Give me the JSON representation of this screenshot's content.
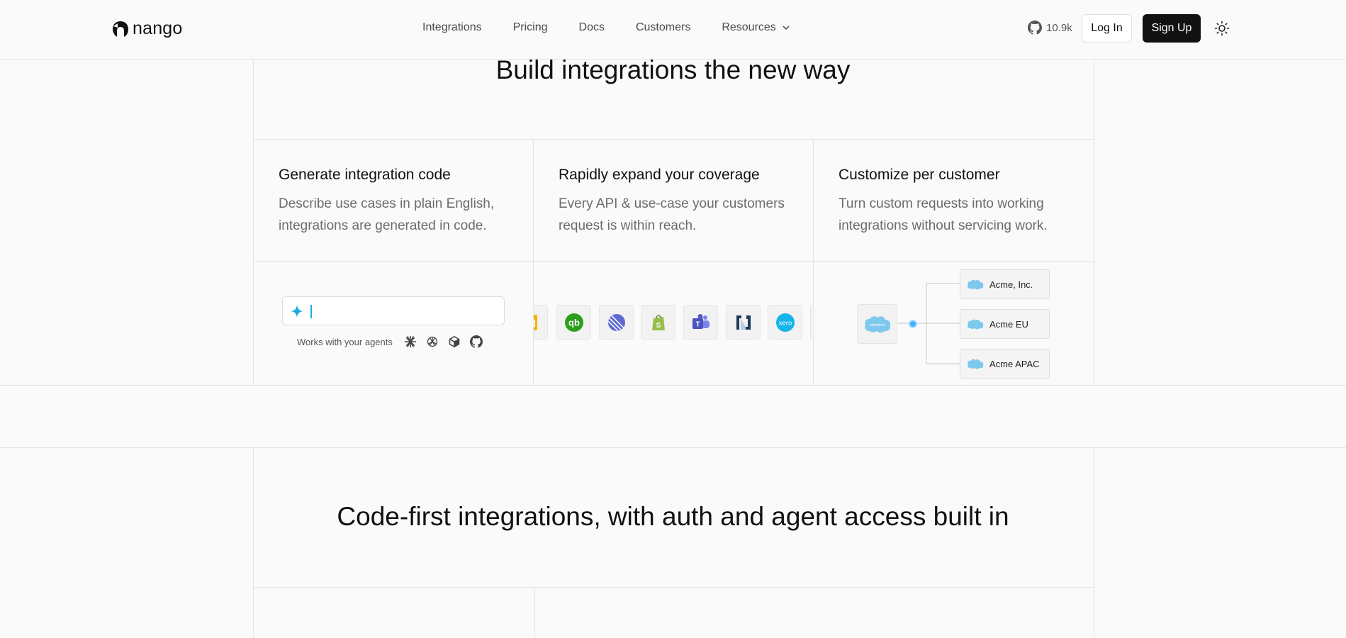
{
  "header": {
    "logo_text": "nango",
    "nav": [
      "Integrations",
      "Pricing",
      "Docs",
      "Customers",
      "Resources"
    ],
    "github_stars": "10.9k",
    "login_label": "Log In",
    "signup_label": "Sign Up"
  },
  "section1": {
    "title": "Build integrations the new way",
    "columns": [
      {
        "title": "Generate integration code",
        "desc": "Describe use cases in plain English, integrations are generated in code."
      },
      {
        "title": "Rapidly expand your coverage",
        "desc": "Every API & use-case your customers request is within reach."
      },
      {
        "title": "Customize per customer",
        "desc": "Turn custom requests into working integrations without servicing work."
      }
    ],
    "agents_label": "Works with your agents",
    "logo_icons": [
      "google-sheets-icon",
      "quickbooks-icon",
      "linear-icon",
      "shopify-icon",
      "microsoft-teams-icon",
      "netsuite-icon",
      "xero-icon"
    ],
    "main_node_icon": "salesforce-icon",
    "customer_nodes": [
      "Acme, Inc.",
      "Acme EU",
      "Acme APAC"
    ]
  },
  "section2": {
    "title": "Code-first integrations, with auth and agent access built in"
  },
  "colors": {
    "accent": "#1ba9e3",
    "salesforce": "#7ec8ee",
    "quickbooks": "#2ca01c",
    "xero": "#13b5ea",
    "shopify": "#95bf47",
    "teams": "#5059c9"
  }
}
